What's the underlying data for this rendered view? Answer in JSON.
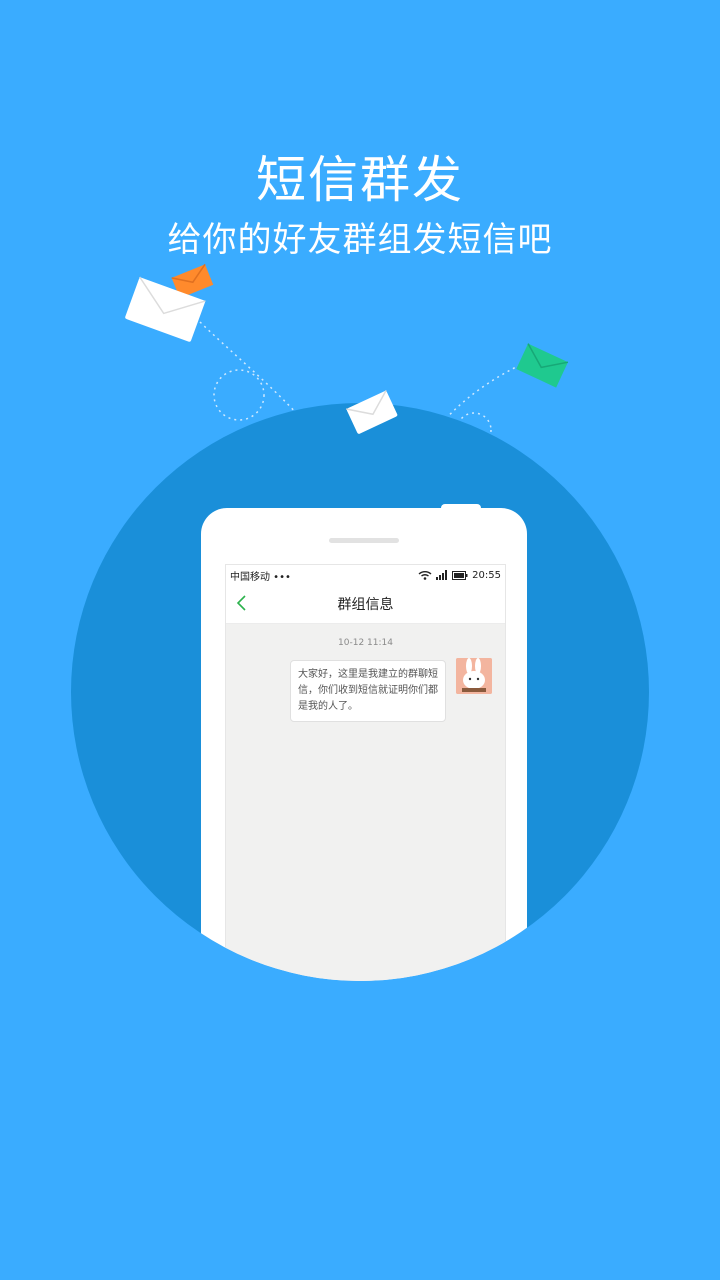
{
  "header": {
    "title": "短信群发",
    "subtitle": "给你的好友群组发短信吧"
  },
  "phone": {
    "status_bar": {
      "carrier": "中国移动 •••",
      "time": "20:55"
    },
    "nav": {
      "title": "群组信息",
      "back_icon": "chevron-left-icon"
    },
    "conversation": {
      "timestamp": "10-12  11:14",
      "message": "大家好，这里是我建立的群聊短信，你们收到短信就证明你们都是我的人了。"
    }
  },
  "colors": {
    "background": "#3aacff",
    "circle": "#1a8fd9",
    "envelope_orange": "#ff8a2c",
    "envelope_green": "#1fc98f",
    "accent_green": "#2bb24c"
  }
}
